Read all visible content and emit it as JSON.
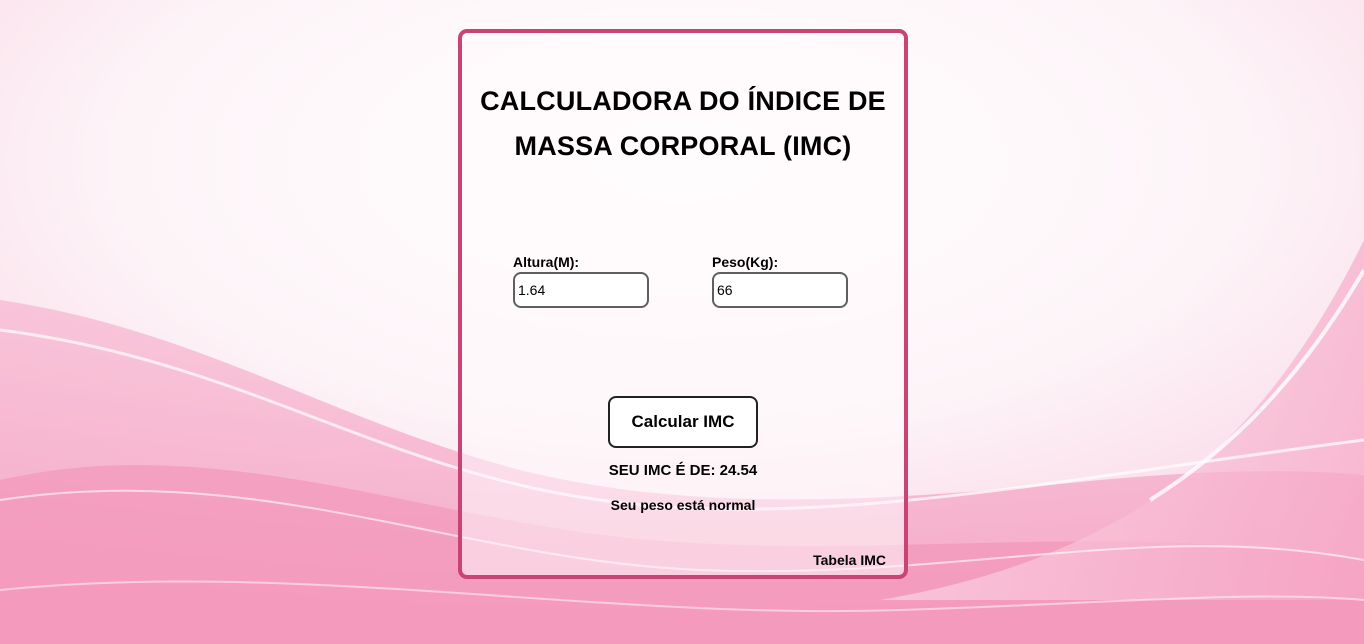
{
  "calculator": {
    "title": "CALCULADORA DO ÍNDICE DE MASSA CORPORAL (IMC)",
    "height_field": {
      "label": "Altura(M):",
      "value": "1.64"
    },
    "weight_field": {
      "label": "Peso(Kg):",
      "value": "66"
    },
    "calculate_button": "Calcular IMC",
    "result_label": "SEU IMC É DE:",
    "result_value": "24.54",
    "status_message": "Seu peso está normal",
    "table_link": "Tabela IMC"
  },
  "colors": {
    "card_border": "#c94473",
    "background_pink": "#f6a8c6",
    "text": "#000000"
  }
}
